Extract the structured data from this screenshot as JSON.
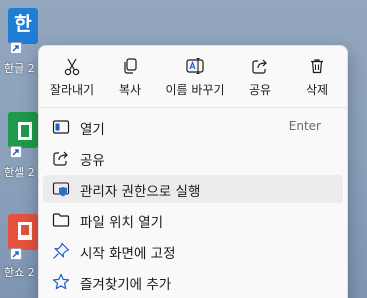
{
  "colors": {
    "desktop": "#8ea3bd",
    "hangul_tile": "#1f7ed4",
    "cell_tile": "#1e9a4a",
    "show_tile": "#e5533d",
    "menu_bg": "#f9f9f9",
    "hover_bg": "#ececec",
    "icon_blue": "#1f5ec8",
    "shield_blue": "#2b6fd6"
  },
  "desktop": {
    "icons": [
      {
        "label": "한글 2",
        "icon": "hangul-app-icon",
        "glyph": "한"
      },
      {
        "label": "한셀 2",
        "icon": "cell-app-icon",
        "glyph": ""
      },
      {
        "label": "한쇼 2",
        "icon": "show-app-icon",
        "glyph": ""
      }
    ]
  },
  "context_menu": {
    "quick_actions": [
      {
        "label": "잘라내기",
        "icon": "scissors-icon"
      },
      {
        "label": "복사",
        "icon": "copy-icon"
      },
      {
        "label": "이름 바꾸기",
        "icon": "rename-icon"
      },
      {
        "label": "공유",
        "icon": "share-icon"
      },
      {
        "label": "삭제",
        "icon": "trash-icon"
      }
    ],
    "items": [
      {
        "label": "열기",
        "icon": "open-icon",
        "shortcut": "Enter"
      },
      {
        "label": "공유",
        "icon": "share-icon",
        "shortcut": ""
      },
      {
        "label": "관리자 권한으로 실행",
        "icon": "shield-icon",
        "shortcut": "",
        "hovered": true
      },
      {
        "label": "파일 위치 열기",
        "icon": "folder-icon",
        "shortcut": ""
      },
      {
        "label": "시작 화면에 고정",
        "icon": "pin-icon",
        "shortcut": ""
      },
      {
        "label": "즐겨찾기에 추가",
        "icon": "star-icon",
        "shortcut": ""
      }
    ]
  }
}
